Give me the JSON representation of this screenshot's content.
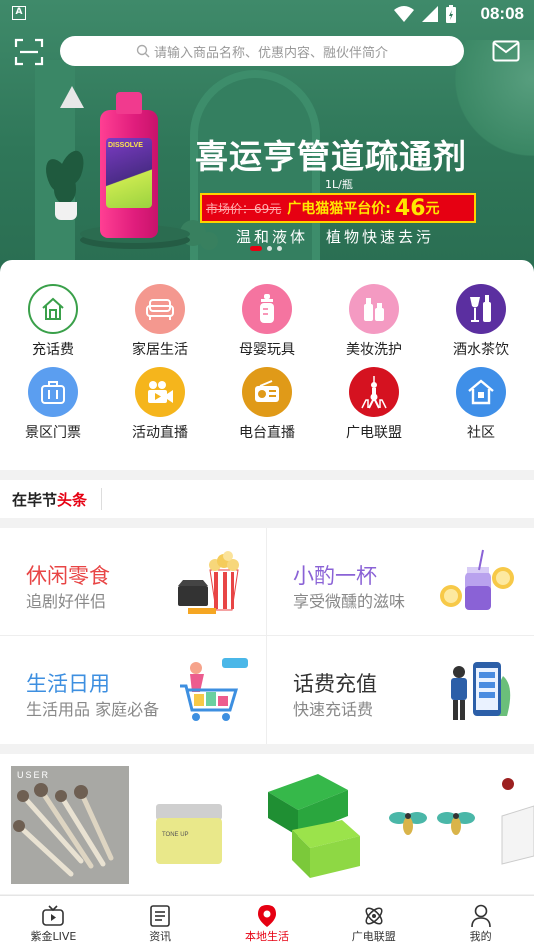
{
  "status_bar": {
    "time": "08:08",
    "notice_glyph": "A"
  },
  "search": {
    "placeholder": "请输入商品名称、优惠内容、融伙伴简介"
  },
  "banner": {
    "title": "喜运亨管道疏通剂",
    "spec": "1L/瓶",
    "old_price": "市场价：69元",
    "platform_label": "广电猫猫平台价:",
    "price": "46",
    "price_unit": "元",
    "slogan": "温和液体　植物快速去污",
    "bottle_text": "DISSOLVE",
    "page_indicator": {
      "count": 3,
      "active": 0
    }
  },
  "grid": [
    {
      "label": "充话费",
      "icon": "house-outline-icon",
      "color": "#ffffff"
    },
    {
      "label": "家居生活",
      "icon": "sofa-icon",
      "color": "#f4988f"
    },
    {
      "label": "母婴玩具",
      "icon": "baby-bottle-icon",
      "color": "#f574a0"
    },
    {
      "label": "美妆洗护",
      "icon": "cosmetics-icon",
      "color": "#f49ac2"
    },
    {
      "label": "酒水茶饮",
      "icon": "wine-bottle-icon",
      "color": "#5b2fa0"
    },
    {
      "label": "景区门票",
      "icon": "ticket-bag-icon",
      "color": "#5b9ef0"
    },
    {
      "label": "活动直播",
      "icon": "video-camera-icon",
      "color": "#f5b51c"
    },
    {
      "label": "电台直播",
      "icon": "radio-icon",
      "color": "#e09a18"
    },
    {
      "label": "广电联盟",
      "icon": "tower-icon",
      "color": "#d51220"
    },
    {
      "label": "社区",
      "icon": "community-house-icon",
      "color": "#3f8fe8"
    }
  ],
  "headline": {
    "brand_prefix": "在毕节",
    "brand_suffix": "头条"
  },
  "promos": [
    {
      "title": "休闲零食",
      "subtitle": "追剧好伴侣",
      "color": "#e84545",
      "icon": "popcorn-icon"
    },
    {
      "title": "小酌一杯",
      "subtitle": "享受微醺的滋味",
      "color": "#8a62d6",
      "icon": "drink-jar-icon"
    },
    {
      "title": "生活日用",
      "subtitle": "生活用品 家庭必备",
      "color": "#3d8fe0",
      "icon": "shopping-cart-icon"
    },
    {
      "title": "话费充值",
      "subtitle": "快速充话费",
      "color": "#333333",
      "icon": "phone-recharge-icon"
    }
  ],
  "products": [
    {
      "name": "makeup-brushes",
      "caption": "USER"
    },
    {
      "name": "face-cream",
      "caption": "TONE UP"
    },
    {
      "name": "green-soap",
      "caption": ""
    },
    {
      "name": "bee-earrings",
      "caption": ""
    },
    {
      "name": "storage-box",
      "caption": ""
    }
  ],
  "tabs": [
    {
      "label": "紫金LIVE",
      "icon": "tv-icon",
      "active": false
    },
    {
      "label": "资讯",
      "icon": "news-icon",
      "active": false
    },
    {
      "label": "本地生活",
      "icon": "location-pin-icon",
      "active": true
    },
    {
      "label": "广电联盟",
      "icon": "atom-icon",
      "active": false
    },
    {
      "label": "我的",
      "icon": "person-icon",
      "active": false
    }
  ],
  "colors": {
    "accent_red": "#e60012",
    "banner_green": "#2f7759"
  }
}
